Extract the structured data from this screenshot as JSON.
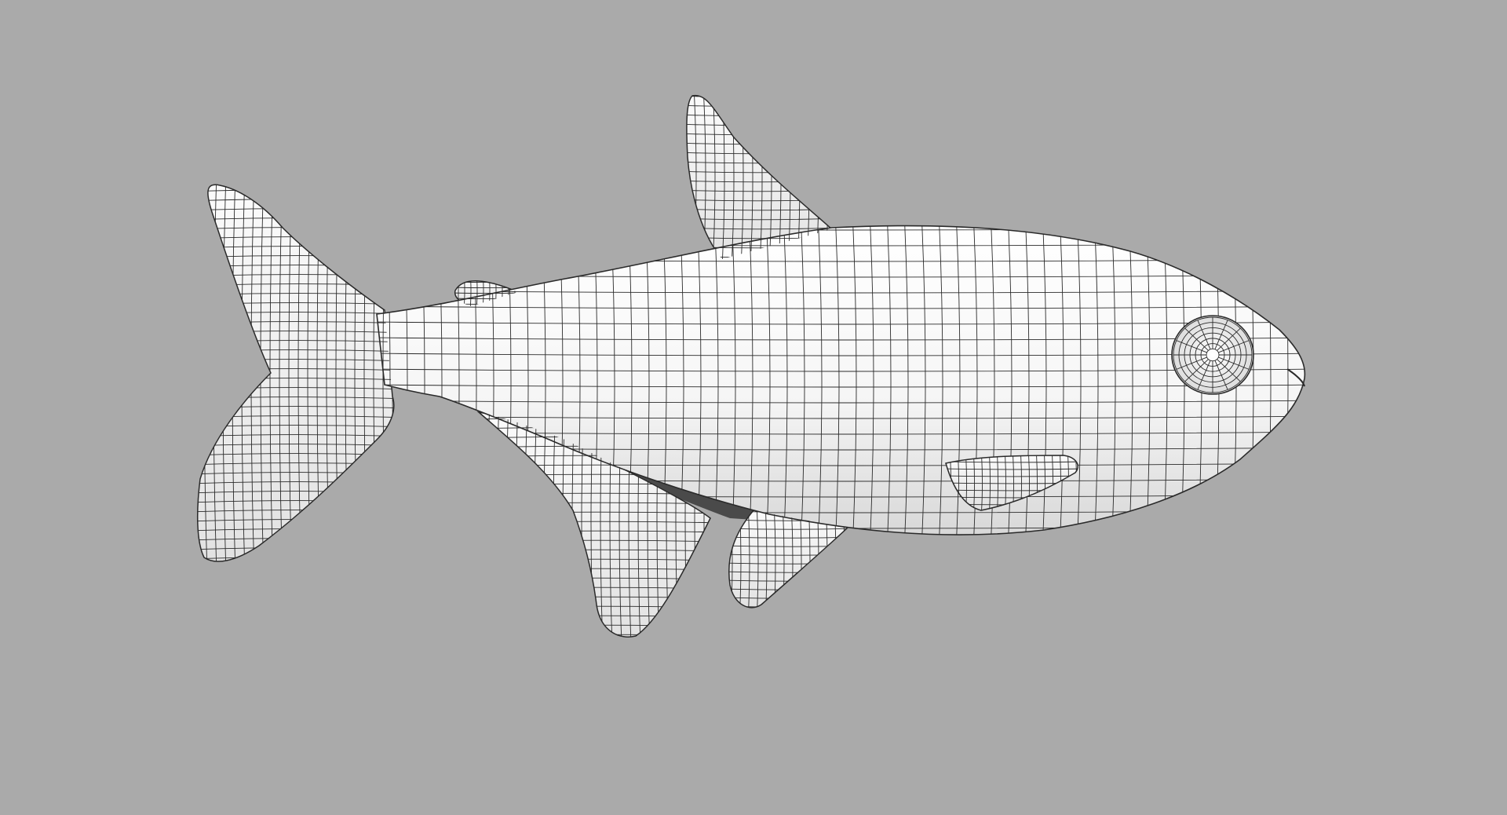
{
  "scene": {
    "subject": "fish",
    "render_style": "wireframe-on-shaded",
    "background_color": "#aaaaaa",
    "surface_color": "#f4f4f4",
    "wire_color": "#2a2a2a",
    "shadow_color": "#c8c8c8"
  }
}
